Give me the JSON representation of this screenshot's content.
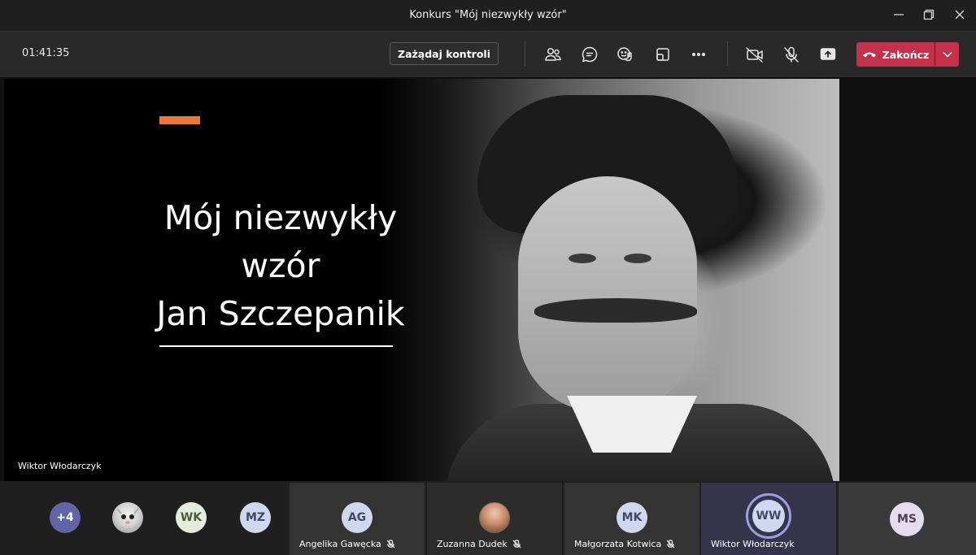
{
  "window": {
    "title": "Konkurs \"Mój niezwykły wzór\""
  },
  "toolbar": {
    "timer": "01:41:35",
    "request_control_label": "Zażądaj kontroli",
    "end_call_label": "Zakończ"
  },
  "slide": {
    "title_lines": [
      "Mój niezwykły",
      "wzór",
      "Jan Szczepanik"
    ],
    "accent_color": "#e8783c",
    "presenter": "Wiktor Włodarczyk"
  },
  "participants": {
    "overflow_label": "+4",
    "small_avatars": [
      {
        "initials": "WK",
        "color": "#e3eddc"
      },
      {
        "initials": "MZ",
        "color": "#cfd8f0"
      }
    ],
    "tiles": [
      {
        "initials": "AG",
        "name": "Angelika Gawęcka",
        "muted": true
      },
      {
        "initials": "",
        "name": "Zuzanna Dudek",
        "muted": true
      },
      {
        "initials": "MK",
        "name": "Małgorzata Kotwica",
        "muted": true
      },
      {
        "initials": "WW",
        "name": "Wiktor Włodarczyk",
        "muted": false
      },
      {
        "initials": "MS",
        "name": "",
        "muted": false
      }
    ]
  },
  "colors": {
    "end_button": "#c4314b",
    "avatar_overflow": "#6264a7",
    "speaking_ring": "#9b9fe0"
  }
}
